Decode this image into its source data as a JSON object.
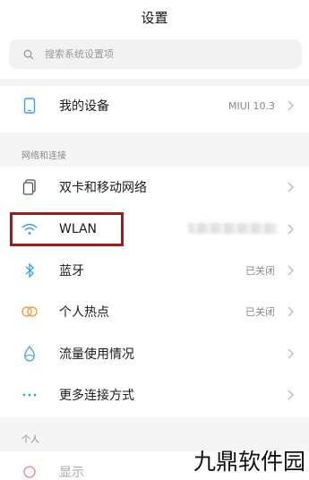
{
  "header": {
    "title": "设置"
  },
  "search": {
    "placeholder": "搜索系统设置项",
    "icon": "search-icon"
  },
  "device": {
    "label": "我的设备",
    "value": "MIUI 10.3",
    "icon": "phone-icon"
  },
  "network": {
    "section_title": "网络和连接",
    "items": [
      {
        "label": "双卡和移动网络",
        "value": "",
        "icon": "sim-cards-icon"
      },
      {
        "label": "WLAN",
        "value": "",
        "icon": "wifi-icon"
      },
      {
        "label": "蓝牙",
        "value": "已关闭",
        "icon": "bluetooth-icon"
      },
      {
        "label": "个人热点",
        "value": "已关闭",
        "icon": "hotspot-icon"
      },
      {
        "label": "流量使用情况",
        "value": "",
        "icon": "data-usage-icon"
      },
      {
        "label": "更多连接方式",
        "value": "",
        "icon": "more-dots-icon"
      }
    ]
  },
  "personal": {
    "section_title": "个人",
    "items": [
      {
        "label": "显示",
        "icon": "display-icon"
      }
    ]
  },
  "watermark": "九鼎软件园",
  "colors": {
    "highlight": "#a01c1c",
    "accent_blue": "#3aa0e8",
    "hotspot_orange": "#f0a040"
  }
}
